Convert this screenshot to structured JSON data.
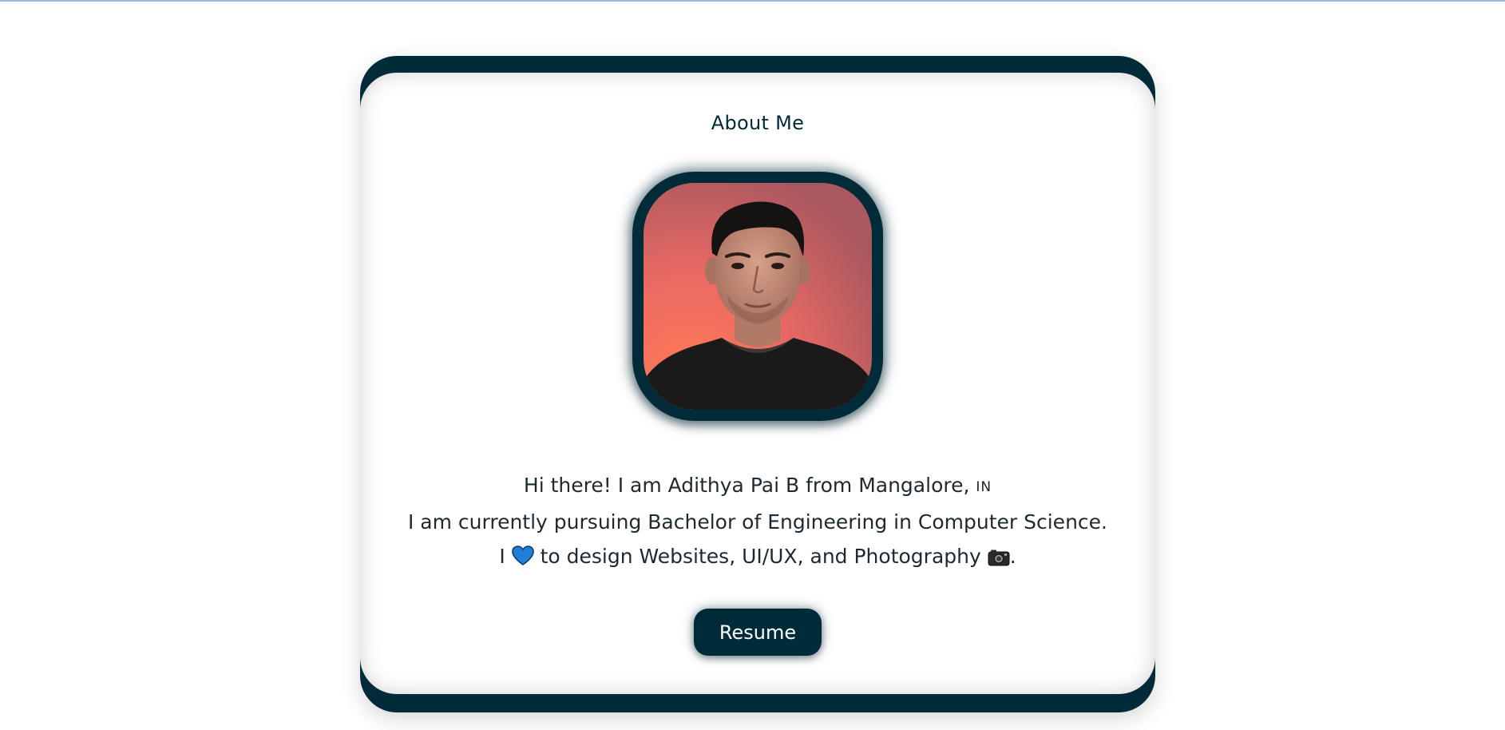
{
  "about": {
    "title": "About Me",
    "bio_line1_text": "Hi there! I am Adithya Pai B from Mangalore, ",
    "bio_line1_flag": "IN",
    "bio_line2": "I am currently pursuing Bachelor of Engineering in Computer Science.",
    "bio_line3_pre": "I ",
    "bio_line3_mid": " to design Websites, UI/UX, and Photography ",
    "bio_line3_post": ".",
    "heart_icon": "blue-heart-icon",
    "camera_icon": "camera-icon",
    "resume_label": "Resume"
  },
  "colors": {
    "accent": "#022b3a",
    "background": "#ffffff",
    "text": "#1e2a31",
    "heart": "#1f7fd6"
  }
}
